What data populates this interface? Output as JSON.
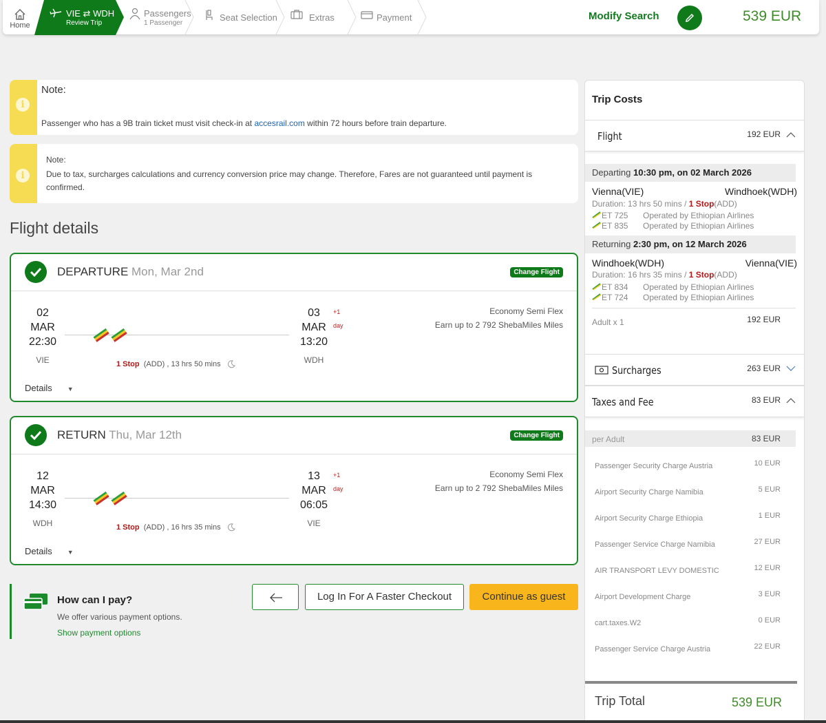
{
  "header": {
    "home_label": "Home",
    "active_route": "VIE ⇄ WDH",
    "active_sub": "Review Trip",
    "steps": [
      {
        "label": "Passengers",
        "sub": "1 Passenger"
      },
      {
        "label": "Seat Selection"
      },
      {
        "label": "Extras"
      },
      {
        "label": "Payment"
      }
    ],
    "modify_search": "Modify Search",
    "total": "539 EUR"
  },
  "notes": [
    {
      "title": "Note:",
      "text_before": "Passenger who has a 9B train ticket must visit check-in at ",
      "link": "accesrail.com",
      "text_after": " within 72 hours before train departure."
    },
    {
      "title": "Note:",
      "text": "Due to tax, surcharges calculations and currency conversion price may change. Therefore, Fares are not guaranteed until payment is confirmed."
    }
  ],
  "flight_details_title": "Flight details",
  "flights": [
    {
      "direction": "DEPARTURE",
      "date": "Mon, Mar 2nd",
      "change_label": "Change Flight",
      "dep_day": "02",
      "dep_month": "MAR",
      "dep_time": "22:30",
      "dep_code": "VIE",
      "arr_day": "03",
      "arr_month": "MAR",
      "arr_time": "13:20",
      "arr_code": "WDH",
      "plus": "+1",
      "plus_unit": "day",
      "stops": "1 Stop",
      "stop_detail": "(ADD) , 13 hrs 50 mins",
      "fare": "Economy Semi Flex",
      "miles": "Earn up to 2 792 ShebaMiles Miles",
      "details": "Details"
    },
    {
      "direction": "RETURN",
      "date": "Thu, Mar 12th",
      "change_label": "Change Flight",
      "dep_day": "12",
      "dep_month": "MAR",
      "dep_time": "14:30",
      "dep_code": "WDH",
      "arr_day": "13",
      "arr_month": "MAR",
      "arr_time": "06:05",
      "arr_code": "VIE",
      "plus": "+1",
      "plus_unit": "day",
      "stops": "1 Stop",
      "stop_detail": "(ADD) , 16 hrs 35 mins",
      "fare": "Economy Semi Flex",
      "miles": "Earn up to 2 792 ShebaMiles Miles",
      "details": "Details"
    }
  ],
  "payment": {
    "title": "How can I pay?",
    "subtitle": "We offer various payment options.",
    "link": "Show payment options"
  },
  "buttons": {
    "login": "Log In For A Faster Checkout",
    "guest": "Continue as guest"
  },
  "trip_costs": {
    "title": "Trip Costs",
    "flight_label": "Flight",
    "flight_amount": "192 EUR",
    "departing_label": "Departing",
    "departing_when": "10:30 pm, on 02 March 2026",
    "out_from": "Vienna(VIE)",
    "out_to": "Windhoek(WDH)",
    "out_duration_prefix": "Duration: 13 hrs 50 mins / ",
    "out_stop": "1 Stop",
    "out_stop_suffix": "(ADD)",
    "out_ops": [
      {
        "flight": "ET 725",
        "operator": "Operated by Ethiopian Airlines"
      },
      {
        "flight": "ET 835",
        "operator": "Operated by Ethiopian Airlines"
      }
    ],
    "returning_label": "Returning",
    "returning_when": "2:30 pm, on 12 March 2026",
    "ret_from": "Windhoek(WDH)",
    "ret_to": "Vienna(VIE)",
    "ret_duration_prefix": "Duration: 16 hrs 35 mins / ",
    "ret_stop": "1 Stop",
    "ret_stop_suffix": "(ADD)",
    "ret_ops": [
      {
        "flight": "ET 834",
        "operator": "Operated by Ethiopian Airlines"
      },
      {
        "flight": "ET 724",
        "operator": "Operated by Ethiopian Airlines"
      }
    ],
    "adult_label": "Adult x 1",
    "adult_amount": "192 EUR",
    "surcharges_label": "Surcharges",
    "surcharges_amount": "263 EUR",
    "taxes_label": "Taxes and Fee",
    "taxes_amount": "83 EUR",
    "per_adult_label": "per Adult",
    "per_adult_amount": "83 EUR",
    "taxes": [
      {
        "name": "Passenger Security Charge Austria",
        "amount": "10 EUR"
      },
      {
        "name": "Airport Security Charge Namibia",
        "amount": "5 EUR"
      },
      {
        "name": "Airport Security Charge Ethiopia",
        "amount": "1 EUR"
      },
      {
        "name": "Passenger Service Charge Namibia",
        "amount": "27 EUR"
      },
      {
        "name": "AIR TRANSPORT LEVY DOMESTIC",
        "amount": "12 EUR"
      },
      {
        "name": "Airport Development Charge",
        "amount": "3 EUR"
      },
      {
        "name": "cart.taxes.W2",
        "amount": "0 EUR"
      },
      {
        "name": "Passenger Service Charge Austria",
        "amount": "22 EUR"
      }
    ],
    "total_label": "Trip Total",
    "total_amount": "539 EUR"
  },
  "colors": {
    "brand_green": "#0e7a1a",
    "accent_yellow": "#f8b51c",
    "note_yellow": "#f5dc52",
    "stop_red": "#b21818",
    "price_green": "#3f8b2a"
  }
}
